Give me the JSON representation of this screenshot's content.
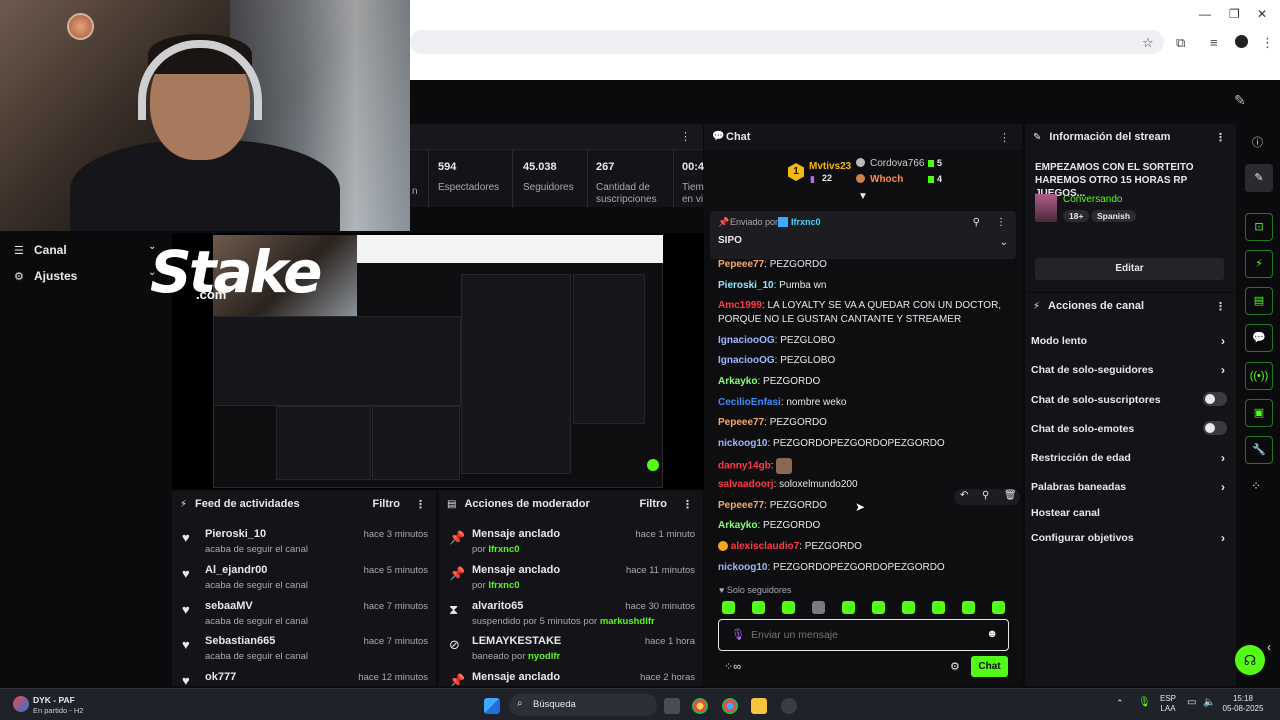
{
  "stats": {
    "items": [
      {
        "value": "594",
        "label": "Espectadores"
      },
      {
        "value": "45.038",
        "label": "Seguidores"
      },
      {
        "value": "267",
        "label": "Cantidad de suscripciones"
      },
      {
        "value": "00:4",
        "label": "Tiem en vi"
      }
    ],
    "partial_label": "n"
  },
  "nav": {
    "canal": "Canal",
    "ajustes": "Ajustes"
  },
  "overlay": {
    "logo": "Stake",
    "logo_sub": ".com"
  },
  "feed": {
    "title": "Feed de actividades",
    "filter": "Filtro",
    "items": [
      {
        "name": "Pieroski_10",
        "sub": "acaba de seguir el canal",
        "time": "hace 3 minutos"
      },
      {
        "name": "Al_ejandr00",
        "sub": "acaba de seguir el canal",
        "time": "hace 5 minutos"
      },
      {
        "name": "sebaaMV",
        "sub": "acaba de seguir el canal",
        "time": "hace 7 minutos"
      },
      {
        "name": "Sebastian665",
        "sub": "acaba de seguir el canal",
        "time": "hace 7 minutos"
      },
      {
        "name": "ok777",
        "sub": "",
        "time": "hace 12 minutos"
      }
    ]
  },
  "mod": {
    "title": "Acciones de moderador",
    "filter": "Filtro",
    "items": [
      {
        "title": "Mensaje anclado",
        "by_prefix": "por",
        "by": "Ifrxnc0",
        "time": "hace 1 minuto"
      },
      {
        "title": "Mensaje anclado",
        "by_prefix": "por",
        "by": "Ifrxnc0",
        "time": "hace 11 minutos"
      },
      {
        "title": "alvarito65",
        "by_prefix": "suspendido por 5 minutos por",
        "by": "markushdlfr",
        "time": "hace 30 minutos"
      },
      {
        "title": "LEMAYKESTAKE",
        "by_prefix": "baneado por",
        "by": "nyodlfr",
        "time": "hace 1 hora"
      },
      {
        "title": "Mensaje anclado",
        "by_prefix": "",
        "by": "",
        "time": "hace 2 horas"
      }
    ]
  },
  "chat": {
    "title": "Chat",
    "leaderboard": {
      "first_rank": "1",
      "first_name": "Mvtivs23",
      "first_count": "22",
      "second_name": "Cordova766",
      "second_count": "5",
      "third_name": "Whoch",
      "third_count": "4"
    },
    "pinned": {
      "sent_by_label": "Enviado por",
      "sent_by": "Ifrxnc0",
      "message": "SIPO"
    },
    "messages": [
      {
        "user": "Pepeee77",
        "color": "#f9a86b",
        "text": "PEZGORDO"
      },
      {
        "user": "Pieroski_10",
        "color": "#8ee7ff",
        "text": "Pumba wn"
      },
      {
        "user": "Amc1999",
        "color": "#ff3a4a",
        "text": "LA LOYALTY SE VA A QUEDAR CON UN DOCTOR, PORQUE NO LE GUSTAN CANTANTE Y STREAMER"
      },
      {
        "user": "IgnaciooOG",
        "color": "#9ab8ff",
        "text": "PEZGLOBO"
      },
      {
        "user": "IgnaciooOG",
        "color": "#9ab8ff",
        "text": "PEZGLOBO"
      },
      {
        "user": "Arkayko",
        "color": "#8bff7a",
        "text": "PEZGORDO"
      },
      {
        "user": "CecilioEnfasi",
        "color": "#3c8dff",
        "text": "nombre weko"
      },
      {
        "user": "Pepeee77",
        "color": "#f9a86b",
        "text": "PEZGORDO"
      },
      {
        "user": "nickoog10",
        "color": "#9ab8ff",
        "text": "PEZGORDOPEZGORDOPEZGORDO"
      },
      {
        "user": "danny14gb",
        "color": "#ff3a4a",
        "text": ""
      },
      {
        "user": "salvaadoorj",
        "color": "#ff3a4a",
        "text": "soloxelmundo200"
      },
      {
        "user": "Pepeee77",
        "color": "#f9a86b",
        "text": "PEZGORDO"
      },
      {
        "user": "Arkayko",
        "color": "#8bff7a",
        "text": "PEZGORDO"
      },
      {
        "user": "alexisclaudio7",
        "color": "#ff3a4a",
        "text": "PEZGORDO"
      },
      {
        "user": "nickoog10",
        "color": "#9ab8ff",
        "text": "PEZGORDOPEZGORDOPEZGORDO"
      }
    ],
    "followers_only": "Solo seguidores",
    "input_placeholder": "Enviar un mensaje",
    "send": "Chat"
  },
  "stream_info": {
    "title": "Información del stream",
    "stream_title": "EMPEZAMOS CON EL SORTEITO HAREMOS OTRO 15 HORAS RP JUEGOS...",
    "category": "Conversando",
    "tags": [
      "18+",
      "Spanish"
    ],
    "edit": "Editar"
  },
  "channel_actions": {
    "title": "Acciones de canal",
    "items": [
      {
        "label": "Modo lento",
        "kind": "chevron"
      },
      {
        "label": "Chat de solo-seguidores",
        "kind": "chevron"
      },
      {
        "label": "Chat de solo-suscriptores",
        "kind": "toggle"
      },
      {
        "label": "Chat de solo-emotes",
        "kind": "toggle"
      },
      {
        "label": "Restricción de edad",
        "kind": "chevron"
      },
      {
        "label": "Palabras baneadas",
        "kind": "chevron"
      },
      {
        "label": "Hostear canal",
        "kind": "none"
      },
      {
        "label": "Configurar objetivos",
        "kind": "chevron"
      }
    ]
  },
  "taskbar": {
    "app_title": "DYK - PAF",
    "app_sub": "En partido - H2",
    "search": "Búsqueda",
    "lang_top": "ESP",
    "lang_bottom": "LAA",
    "time": "15:18",
    "date": "05-08-2025"
  },
  "colors": {
    "accent": "#53fc18",
    "background": "#0b0b0d",
    "panel": "#141418"
  }
}
